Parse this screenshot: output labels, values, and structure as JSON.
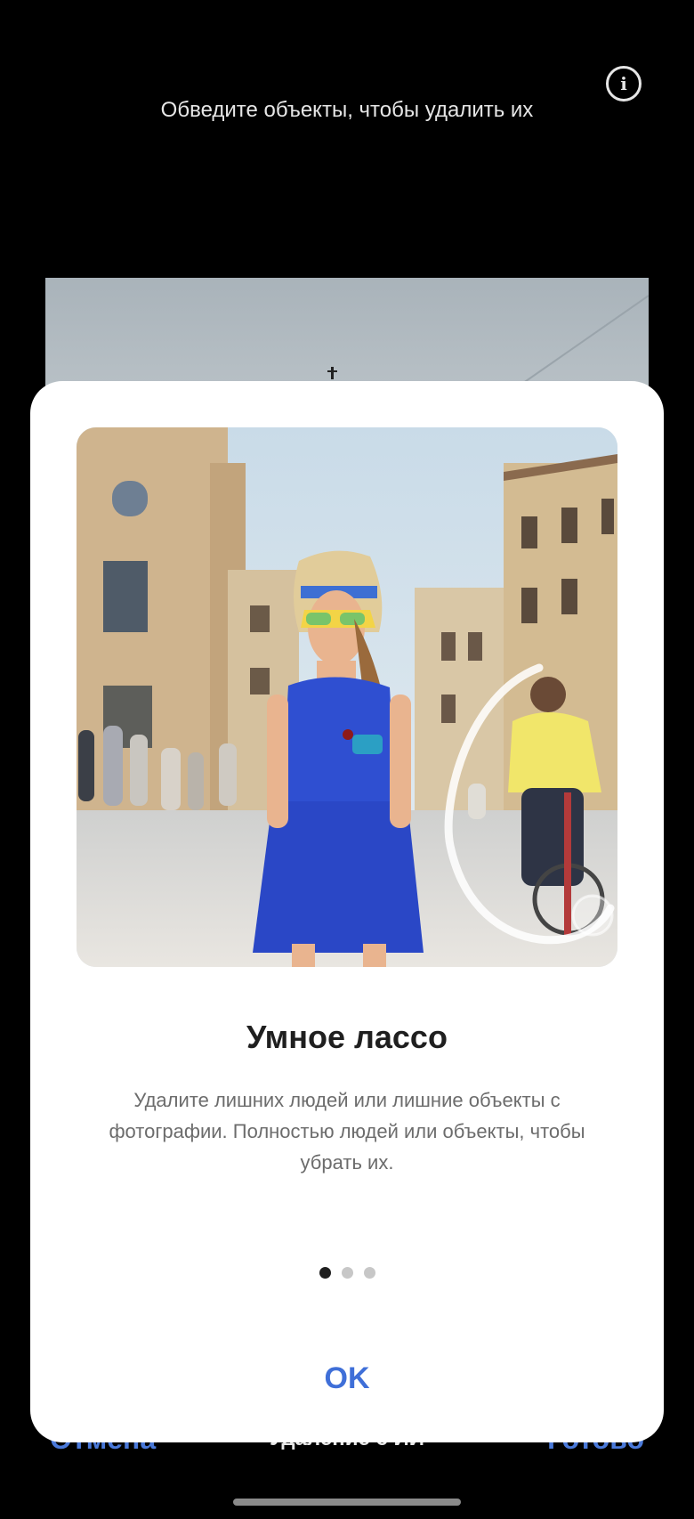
{
  "header": {
    "hint": "Обведите объекты, чтобы удалить их",
    "info_icon": "info-icon",
    "info_glyph": "i"
  },
  "bottom_bar": {
    "cancel": "Отмена",
    "mode": "Удаление с ИИ",
    "done": "Готово"
  },
  "dialog": {
    "title": "Умное лассо",
    "body": "Удалите лишних людей или лишние объекты с фотографии. Полностью людей или объекты, чтобы убрать их.",
    "pager": {
      "count": 3,
      "active_index": 0
    },
    "ok": "OK"
  },
  "colors": {
    "accent": "#3f6fd8",
    "dialog_bg": "#ffffff",
    "screen_bg": "#000000"
  }
}
